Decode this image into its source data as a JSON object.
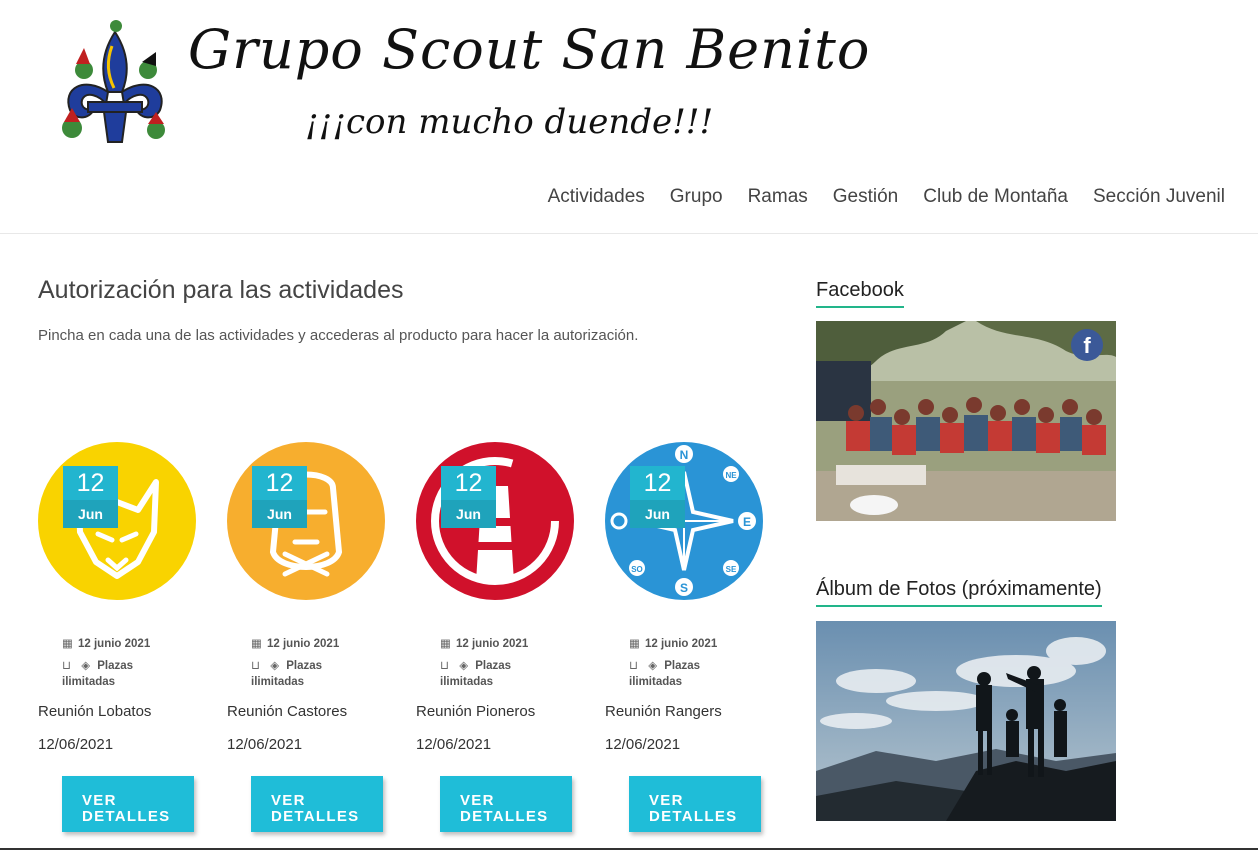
{
  "site": {
    "title": "Grupo Scout San Benito",
    "tagline": "¡¡¡con mucho duende!!!"
  },
  "nav": [
    "Actividades",
    "Grupo",
    "Ramas",
    "Gestión",
    "Club de Montaña",
    "Sección Juvenil"
  ],
  "page": {
    "title": "Autorización para las actividades",
    "intro": "Pincha en cada una de las actividades y accederas al producto para hacer la autorización."
  },
  "products": [
    {
      "day": "12",
      "month": "Jun",
      "date_text": "12 junio 2021",
      "places": "Plazas",
      "places2": "ilimitadas",
      "name": "Reunión Lobatos",
      "price": "12/06/2021",
      "button": "VER DETALLES",
      "color": "#f9d300",
      "icon": "wolf-emblem-icon"
    },
    {
      "day": "12",
      "month": "Jun",
      "date_text": "12 junio 2021",
      "places": "Plazas",
      "places2": "ilimitadas",
      "name": "Reunión Castores",
      "price": "12/06/2021",
      "button": "VER DETALLES",
      "color": "#f7ae2e",
      "icon": "beaver-emblem-icon"
    },
    {
      "day": "12",
      "month": "Jun",
      "date_text": "12 junio 2021",
      "places": "Plazas",
      "places2": "ilimitadas",
      "name": "Reunión Pioneros",
      "price": "12/06/2021",
      "button": "VER DETALLES",
      "color": "#d0112b",
      "icon": "lighthouse-emblem-icon"
    },
    {
      "day": "12",
      "month": "Jun",
      "date_text": "12 junio 2021",
      "places": "Plazas",
      "places2": "ilimitadas",
      "name": "Reunión Rangers",
      "price": "12/06/2021",
      "button": "VER DETALLES",
      "color": "#2a94d6",
      "icon": "compass-rose-icon"
    }
  ],
  "compass": {
    "n": "N",
    "ne": "NE",
    "e": "E",
    "se": "SE",
    "s": "S",
    "so": "SO"
  },
  "sidebar": {
    "facebook_title": "Facebook",
    "album_title": "Álbum de Fotos (próximamente)"
  },
  "colors": {
    "accent": "#1fbdd8",
    "widget_underline": "#22b58a",
    "facebook": "#3b5998"
  }
}
